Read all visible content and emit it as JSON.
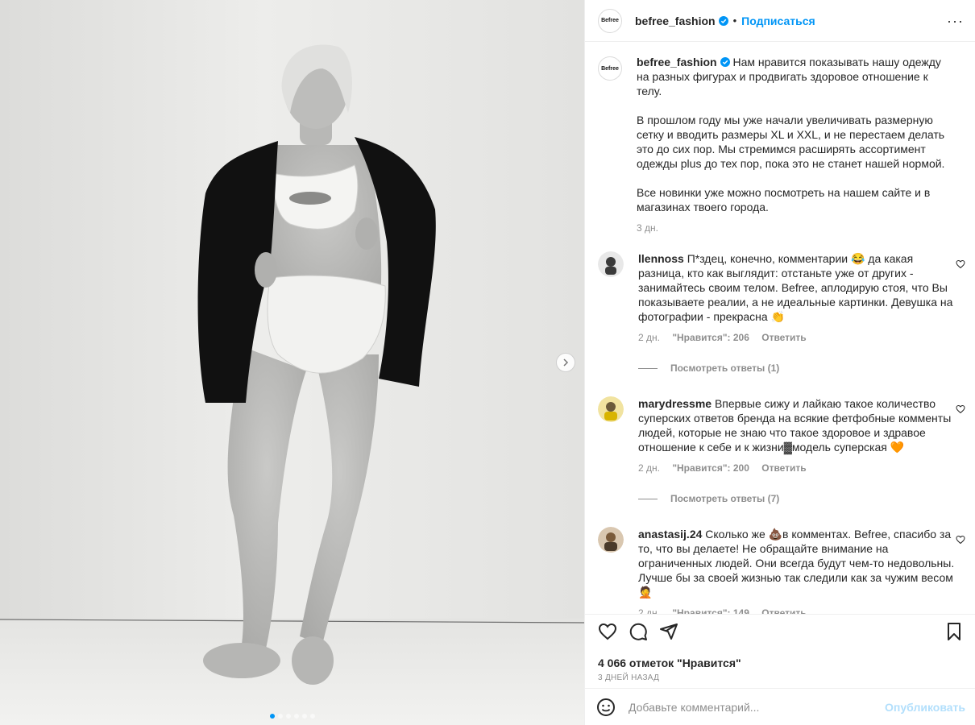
{
  "post": {
    "username": "befree_fashion",
    "avatar_text": "Befree",
    "separator": "•",
    "follow_label": "Подписаться",
    "more_label": "···",
    "verified": true,
    "caption_p1": "Нам нравится показывать нашу одежду на разных фигурах и продвигать здоровое отношение к телу.",
    "caption_p2": "В прошлом году мы уже начали увеличивать размерную сетку и вводить размеры XL и XXL, и не перестаем делать это до сих пор. Мы стремимся расширять ассортимент одежды plus до тех пор, пока это не станет нашей нормой.",
    "caption_p3": "Все новинки уже можно посмотреть на нашем сайте и в магазинах твоего города.",
    "caption_time": "3 дн."
  },
  "media": {
    "carousel_total": 6,
    "carousel_index": 1,
    "next_icon": "chevron-right-icon"
  },
  "comments": [
    {
      "username": "llennoss",
      "text": "П*здец, конечно, комментарии 😂 да какая разница, кто как выглядит: отстаньте уже от других - занимайтесь своим телом. Befree, аплодирую стоя, что Вы показываете реалии, а не идеальные картинки. Девушка на фотографии - прекрасна 👏",
      "time": "2 дн.",
      "likes": "\"Нравится\": 206",
      "reply": "Ответить",
      "view_replies": "Посмотреть ответы (1)",
      "avatar_color": "#3a3a3a"
    },
    {
      "username": "marydressme",
      "text": "Впервые сижу и лайкаю такое количество суперских ответов бренда на всякие фетфобные комменты людей, которые не знаю что такое здоровое и здравое отношение к себе и к жизни▓модель суперская 🧡",
      "time": "2 дн.",
      "likes": "\"Нравится\": 200",
      "reply": "Ответить",
      "view_replies": "Посмотреть ответы (7)",
      "avatar_color": "#d8b400"
    },
    {
      "username": "anastasij.24",
      "text": "Сколько же 💩в комментах. Befree, спасибо за то, что вы делаете! Не обращайте внимание на ограниченных людей. Они всегда будут чем-то недовольны. Лучше бы за своей жизнью так следили как за чужим весом 🤦",
      "time": "2 дн.",
      "likes": "\"Нравится\": 149",
      "reply": "Ответить",
      "avatar_color": "#7a5a3a"
    }
  ],
  "footer": {
    "likes_count": "4 066 отметок \"Нравится\"",
    "posted_ago": "3 ДНЕЙ НАЗАД",
    "comment_placeholder": "Добавьте комментарий...",
    "publish_label": "Опубликовать"
  },
  "colors": {
    "accent": "#0095f6",
    "muted": "#8e8e8e",
    "publish_disabled": "#b2dffc"
  }
}
